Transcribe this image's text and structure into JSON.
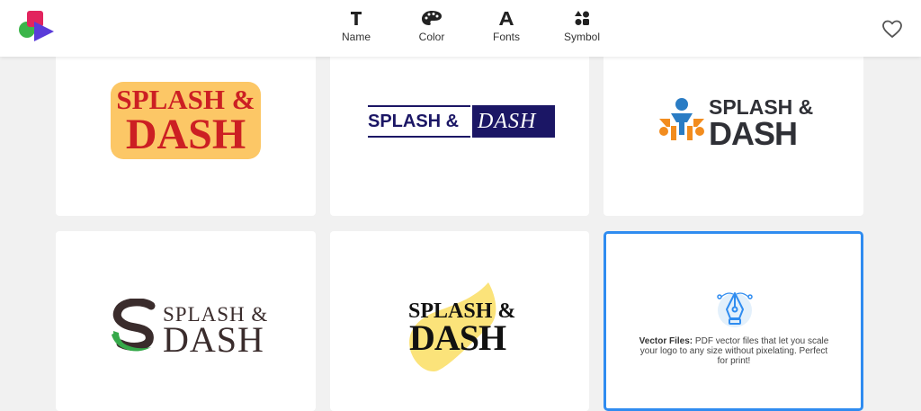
{
  "app": {
    "logo_icon": "app-logo-icon",
    "favorite_icon": "heart-icon"
  },
  "nav": [
    {
      "label": "Name",
      "icon": "text-T-icon"
    },
    {
      "label": "Color",
      "icon": "palette-icon"
    },
    {
      "label": "Fonts",
      "icon": "font-A-icon"
    },
    {
      "label": "Symbol",
      "icon": "shapes-icon"
    }
  ],
  "logos": [
    {
      "line1": "SPLASH &",
      "line2": "DASH",
      "colors": {
        "bg": "#fcc766",
        "text": "#cc1f23"
      }
    },
    {
      "line1": "SPLASH &",
      "line2": "DASH",
      "colors": {
        "bg": "#1b1665",
        "text": "#ffffff"
      }
    },
    {
      "line1": "SPLASH &",
      "line2": "DASH",
      "colors": {
        "text": "#2f3036",
        "accent_blue": "#2a7cc4",
        "accent_orange": "#f28c1e"
      }
    },
    {
      "line1": "SPLASH &",
      "line2": "DASH",
      "colors": {
        "text": "#3a2c2c",
        "accent": "#36a94a"
      }
    },
    {
      "line1": "SPLASH &",
      "line2": "DASH",
      "colors": {
        "text": "#111111",
        "accent": "#fbe37a"
      }
    }
  ],
  "info_card": {
    "title": "Vector Files:",
    "text": "PDF vector files that let you scale your logo to any size without pixelating. Perfect for print!",
    "icon": "pen-tool-icon",
    "border_color": "#2f8cf0"
  }
}
